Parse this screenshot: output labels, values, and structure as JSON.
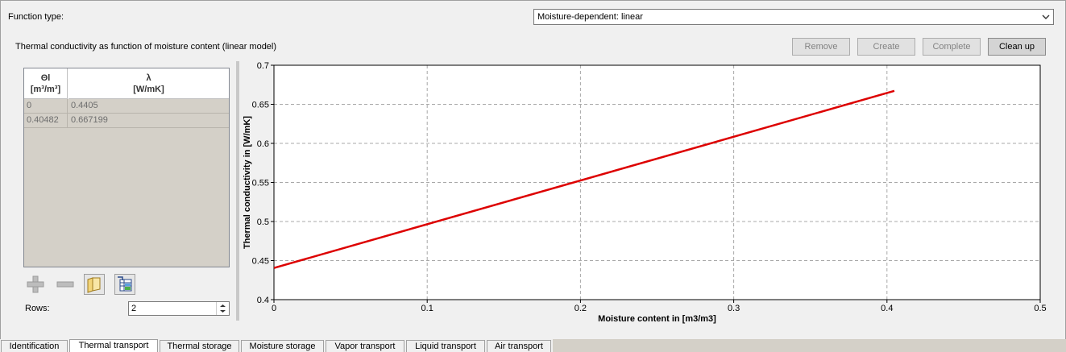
{
  "function_type": {
    "label": "Function type:",
    "selected": "Moisture-dependent: linear"
  },
  "section_title": "Thermal conductivity as function of moisture content (linear model)",
  "buttons": {
    "remove": "Remove",
    "create": "Create",
    "complete": "Complete",
    "cleanup": "Clean up"
  },
  "table": {
    "col1": {
      "line1": "Θl",
      "line2": "[m³/m³]"
    },
    "col2": {
      "line1": "λ",
      "line2": "[W/mK]"
    },
    "rows": [
      [
        "0",
        "0.4405"
      ],
      [
        "0.40482",
        "0.667199"
      ]
    ]
  },
  "toolbar_icons": [
    "add-row-icon",
    "remove-row-icon",
    "open-folder-icon",
    "import-table-icon"
  ],
  "rows_field": {
    "label": "Rows:",
    "value": "2"
  },
  "chart_data": {
    "type": "line",
    "xlabel": "Moisture content in [m3/m3]",
    "ylabel": "Thermal conductivity in [W/mK]",
    "xlim": [
      0,
      0.5
    ],
    "ylim": [
      0.4,
      0.7
    ],
    "xticks": [
      "0",
      "0.1",
      "0.2",
      "0.3",
      "0.4",
      "0.5"
    ],
    "yticks": [
      "0.4",
      "0.45",
      "0.5",
      "0.55",
      "0.6",
      "0.65",
      "0.7"
    ],
    "grid": true,
    "series": [
      {
        "x": [
          0,
          0.40482
        ],
        "y": [
          0.4405,
          0.667199
        ],
        "color": "#dd0000"
      }
    ]
  },
  "tabs": [
    "Identification",
    "Thermal transport",
    "Thermal storage",
    "Moisture storage",
    "Vapor transport",
    "Liquid transport",
    "Air transport"
  ],
  "active_tab": "Thermal transport"
}
